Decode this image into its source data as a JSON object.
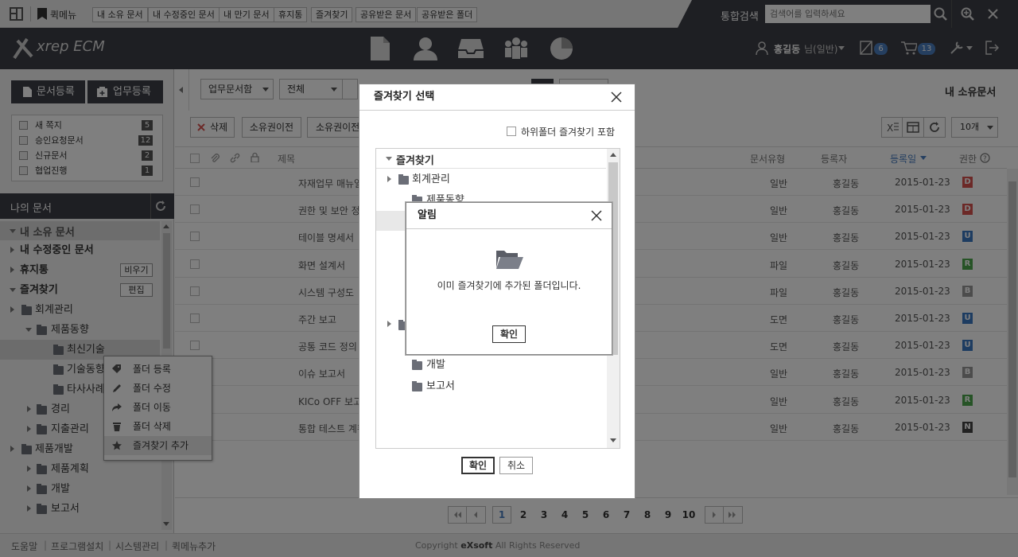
{
  "quickbar": {
    "label": "퀵메뉴",
    "items": [
      "내 소유 문서",
      "내 수정중인 문서",
      "내 만기 문서",
      "휴지통",
      "즐겨찾기",
      "공유받은 문서",
      "공유받은 폴더"
    ],
    "search_label": "통합검색",
    "search_placeholder": "검색어를 입력하세요"
  },
  "header": {
    "logo": "xrep ECM",
    "user": "홍길동",
    "user_role": "님(일반)",
    "notify_count": "6",
    "cart_count": "13"
  },
  "left": {
    "register_doc": "문서등록",
    "register_task": "업무등록",
    "stats": [
      {
        "label": "새 쪽지",
        "count": "5"
      },
      {
        "label": "승인요청문서",
        "count": "12"
      },
      {
        "label": "신규문서",
        "count": "2"
      },
      {
        "label": "협업진행",
        "count": "1"
      }
    ],
    "my_docs_title": "나의 문서",
    "nav": {
      "owned": "내 소유 문서",
      "editing": "내 수정중인 문서",
      "trash": "휴지통",
      "empty_btn": "비우기",
      "favorites": "즐겨찾기",
      "edit_btn": "편집"
    },
    "tree": [
      "회계관리",
      "제품동향",
      "최신기술",
      "기술동향",
      "타사사례",
      "경리",
      "지출관리",
      "제품개발",
      "제품계획",
      "개발",
      "보고서"
    ]
  },
  "toolbar": {
    "doc_type_select": "업무문서함",
    "scope_select": "전체",
    "delete": "삭제",
    "transfer1": "소유권이전",
    "transfer2": "소유권이전",
    "page_size": "10개",
    "page_title": "내 소유문서"
  },
  "table": {
    "headers": {
      "title": "제목",
      "type": "문서유형",
      "author": "등록자",
      "date": "등록일",
      "perm": "권한"
    },
    "rows": [
      {
        "title": "자재업무 매뉴얼",
        "type": "일반",
        "author": "홍길동",
        "date": "2015-01-23",
        "perm": "D",
        "color": "#d9534f"
      },
      {
        "title": "권한 및 보안 정책",
        "type": "일반",
        "author": "홍길동",
        "date": "2015-01-23",
        "perm": "D",
        "color": "#d9534f"
      },
      {
        "title": "테이블 명세서",
        "type": "일반",
        "author": "홍길동",
        "date": "2015-01-23",
        "perm": "U",
        "color": "#3a78c3"
      },
      {
        "title": "화면 설계서",
        "type": "파일",
        "author": "홍길동",
        "date": "2015-01-23",
        "perm": "R",
        "color": "#4ca64c"
      },
      {
        "title": "시스템 구성도",
        "type": "파일",
        "author": "홍길동",
        "date": "2015-01-23",
        "perm": "B",
        "color": "#999999"
      },
      {
        "title": "주간 보고",
        "type": "도면",
        "author": "홍길동",
        "date": "2015-01-23",
        "perm": "U",
        "color": "#3a78c3"
      },
      {
        "title": "공통 코드 정의",
        "type": "도면",
        "author": "홍길동",
        "date": "2015-01-23",
        "perm": "U",
        "color": "#3a78c3"
      },
      {
        "title": "이슈 보고서",
        "type": "일반",
        "author": "홍길동",
        "date": "2015-01-23",
        "perm": "B",
        "color": "#999999"
      },
      {
        "title": "KICo OFF 보고",
        "type": "일반",
        "author": "홍길동",
        "date": "2015-01-23",
        "perm": "R",
        "color": "#4ca64c"
      },
      {
        "title": "통합 테스트 계획",
        "type": "일반",
        "author": "홍길동",
        "date": "2015-01-23",
        "perm": "N",
        "color": "#444444"
      }
    ]
  },
  "pagination": [
    "1",
    "2",
    "3",
    "4",
    "5",
    "6",
    "7",
    "8",
    "9",
    "10"
  ],
  "footer": {
    "links": [
      "도움말",
      "프로그램설치",
      "시스템관리",
      "퀵메뉴추가"
    ],
    "copyright_prefix": "Copyright",
    "brand": "eXsoft",
    "copyright_suffix": "All Rights Reserved"
  },
  "context_menu": [
    "폴더 등록",
    "폴더 수정",
    "폴더 이동",
    "폴더 삭제",
    "즐겨찾기 추가"
  ],
  "fav_dialog": {
    "title": "즐겨찾기 선택",
    "include_sub": "하위폴더 즐겨찾기 포함",
    "root": "즐겨찾기",
    "nodes": [
      "회계관리",
      "제품동향",
      "개발",
      "보고서"
    ],
    "ok": "확인",
    "cancel": "취소"
  },
  "alert": {
    "title": "알림",
    "message": "이미 즐겨찾기에 추가된 폴더입니다.",
    "ok": "확인"
  }
}
